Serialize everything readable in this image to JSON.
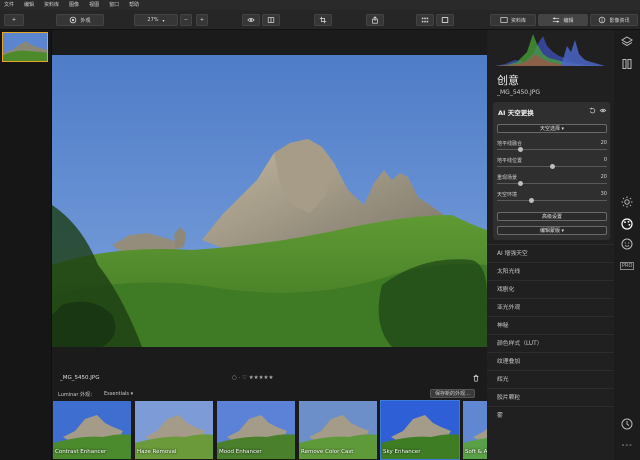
{
  "menu": [
    "文件",
    "编辑",
    "资料库",
    "图像",
    "视图",
    "窗口",
    "帮助"
  ],
  "toolbar": {
    "add_label": "+",
    "looks_label": "外观",
    "zoom_value": "27%",
    "zoom_minus": "−",
    "zoom_plus": "+",
    "library_tab": "资料库",
    "edit_tab": "编辑",
    "info_tab": "影像资讯"
  },
  "panel": {
    "title": "创意",
    "filename": "_MG_5450.JPG",
    "card_title": "AI 天空更换",
    "sky_select": "天空选择 ▾",
    "sliders": [
      {
        "name": "地平线融合",
        "value": "20",
        "fraction": 0.2
      },
      {
        "name": "地平线位置",
        "value": "0",
        "fraction": 0.5
      },
      {
        "name": "重现场景",
        "value": "20",
        "fraction": 0.2
      },
      {
        "name": "天空环境",
        "value": "30",
        "fraction": 0.3
      }
    ],
    "advanced_label": "高级设置",
    "mask_label": "编辑蒙版 ▾",
    "tools": [
      "AI 增强天空",
      "太阳光线",
      "戏剧化",
      "亚光外观",
      "神秘",
      "颜色样式（LUT）",
      "纹理叠加",
      "辉光",
      "胶片颗粒",
      "雾"
    ]
  },
  "image_info": {
    "filename": "_MG_5450.JPG",
    "rating_icons": "○ ·  ♡  ★★★★★"
  },
  "looks": {
    "label": "Luminar 外观：",
    "category": "Essentials ▾",
    "save_label": "保存新的外观…",
    "presets": [
      "Contrast Enhancer",
      "Haze Removal",
      "Mood Enhancer",
      "Remove Color Cast",
      "Sky Enhancer",
      "Soft & Airy"
    ]
  },
  "colors": {
    "accent": "#e3a628",
    "sky": "#5b86cf",
    "foliage": "#4d8a2b"
  }
}
